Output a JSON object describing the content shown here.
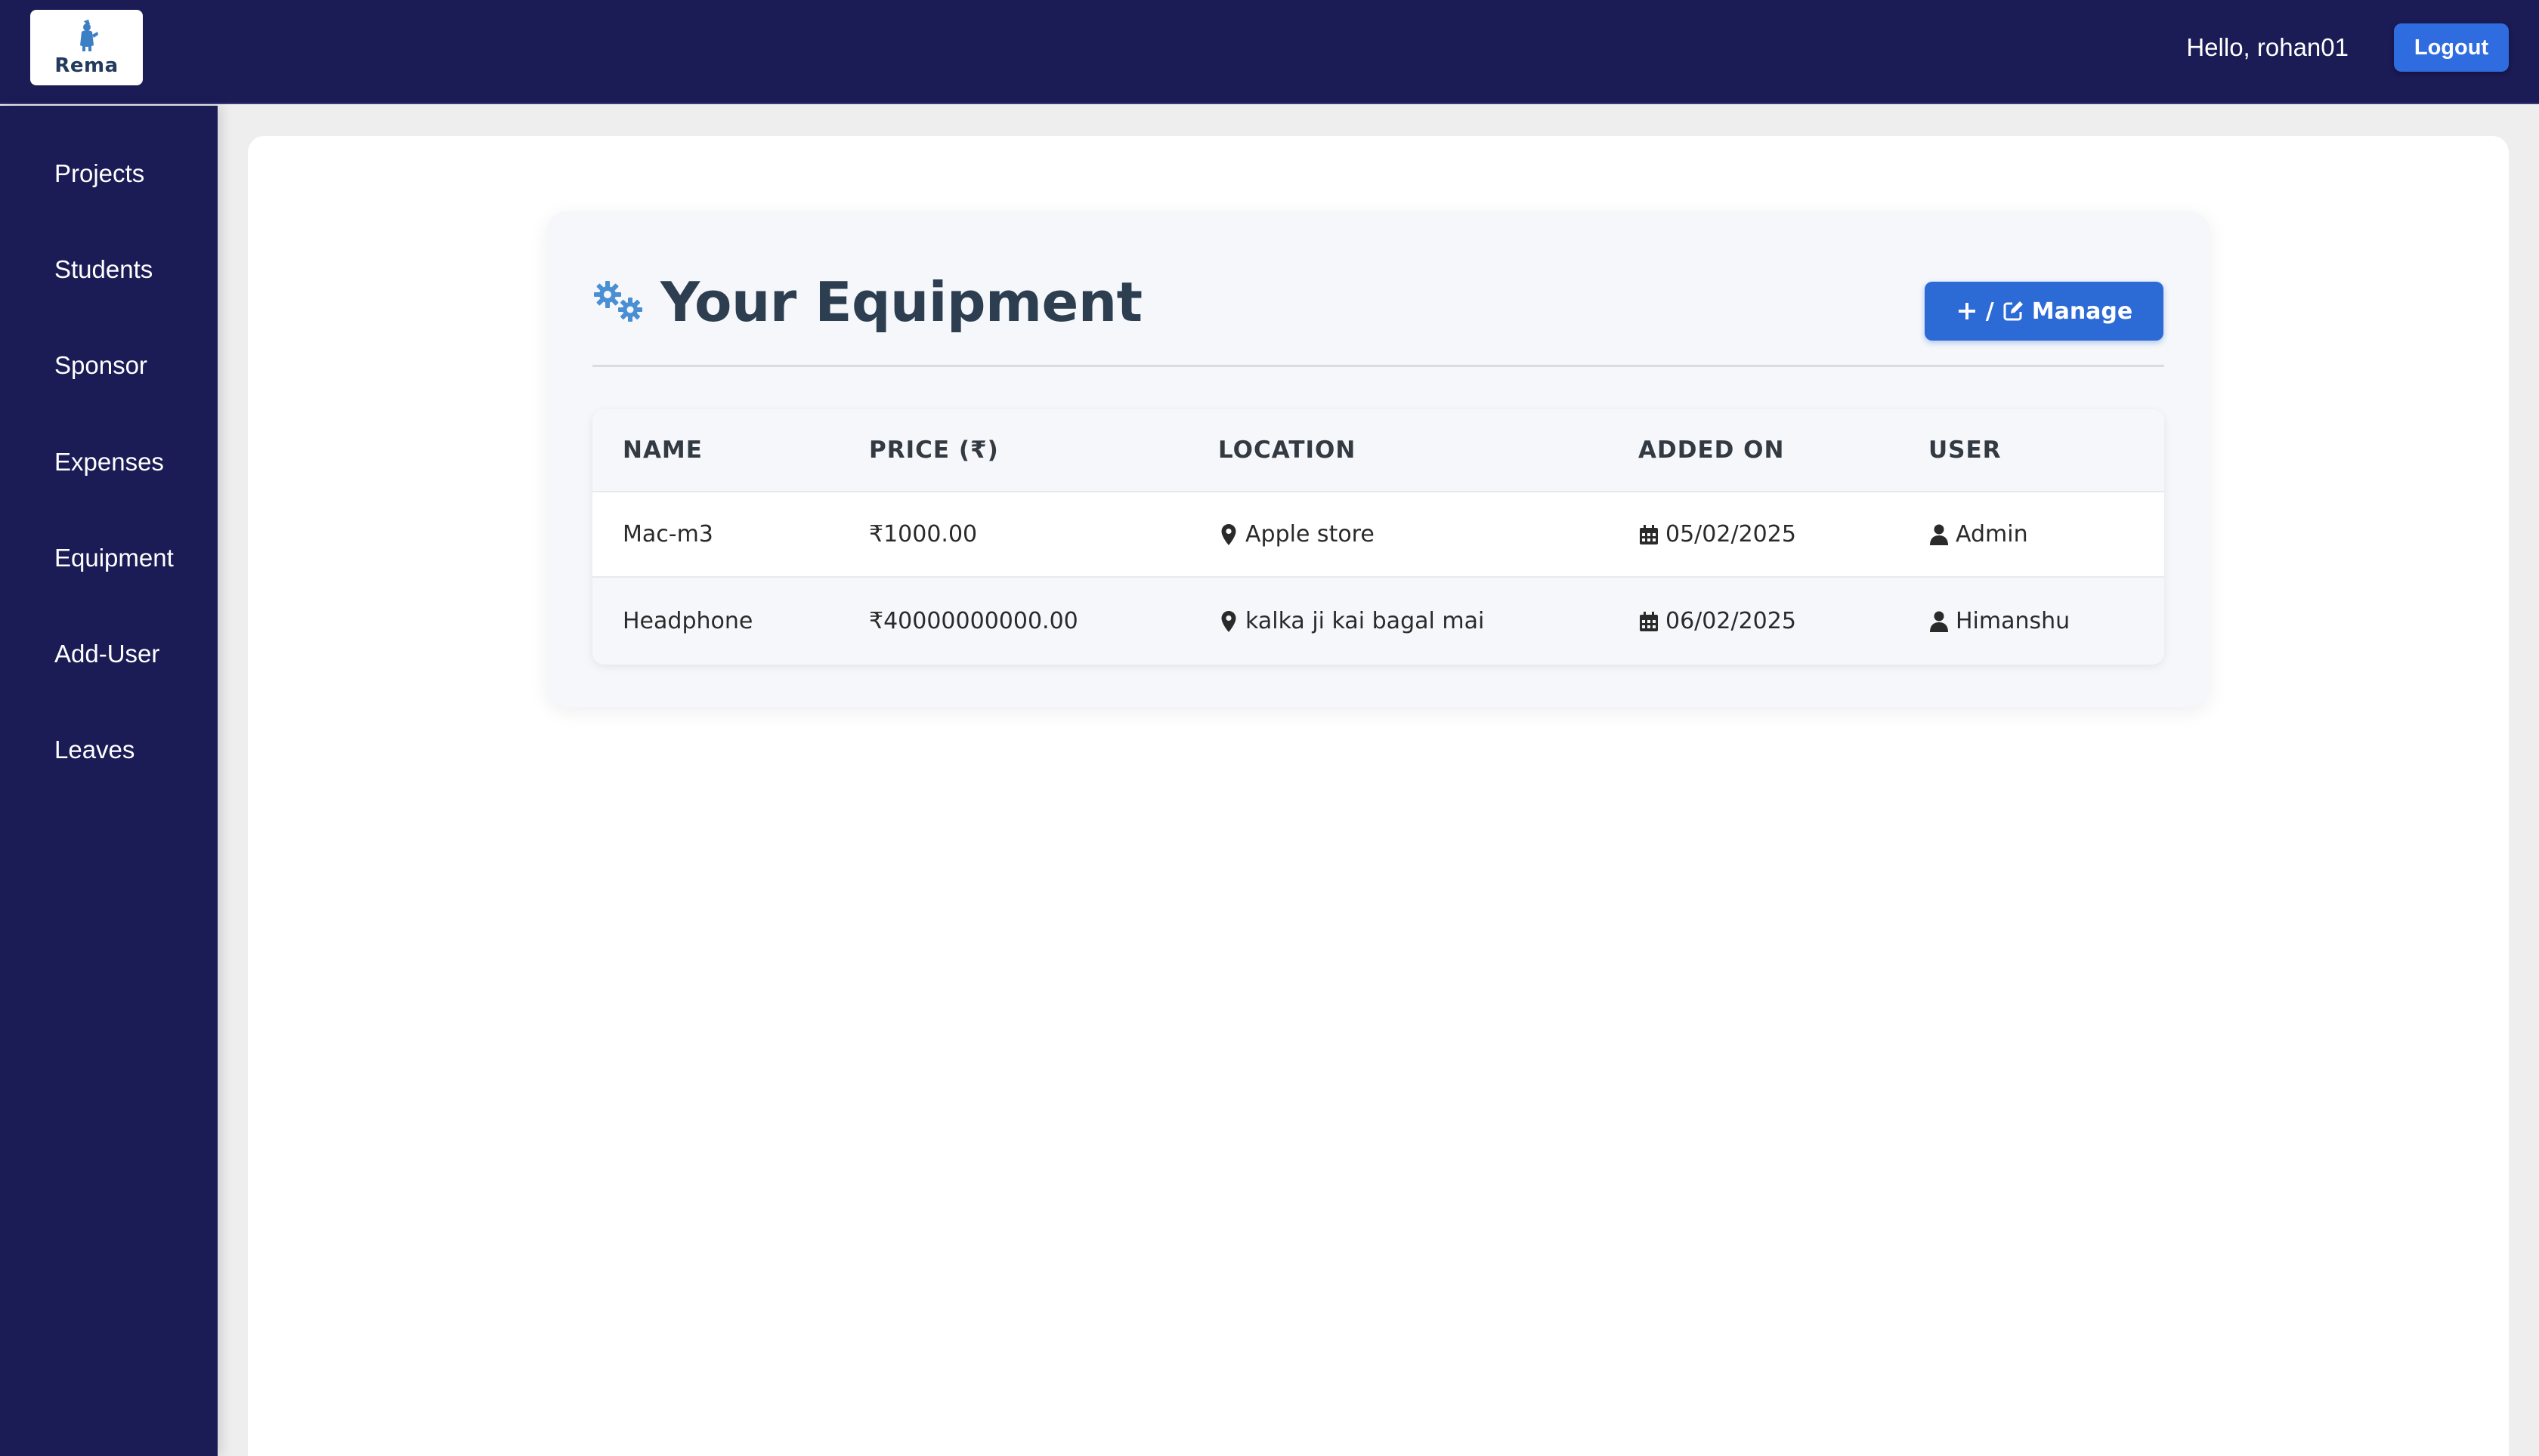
{
  "header": {
    "logo_text": "Rema",
    "greeting": "Hello, rohan01",
    "logout_label": "Logout"
  },
  "sidebar": {
    "items": [
      {
        "label": "Projects"
      },
      {
        "label": "Students"
      },
      {
        "label": "Sponsor"
      },
      {
        "label": "Expenses"
      },
      {
        "label": "Equipment"
      },
      {
        "label": "Add-User"
      },
      {
        "label": "Leaves"
      }
    ]
  },
  "equipment": {
    "title": "Your Equipment",
    "manage_label": "Manage",
    "manage_separator": "/",
    "columns": [
      "NAME",
      "PRICE (₹)",
      "LOCATION",
      "ADDED ON",
      "USER"
    ],
    "rows": [
      {
        "name": "Mac-m3",
        "price": "₹1000.00",
        "location": "Apple store",
        "added_on": "05/02/2025",
        "user": "Admin"
      },
      {
        "name": "Headphone",
        "price": "₹40000000000.00",
        "location": "kalka ji kai bagal mai",
        "added_on": "06/02/2025",
        "user": "Himanshu"
      }
    ]
  },
  "icons": {
    "title_icon": "gears-icon",
    "add_icon": "plus-icon",
    "edit_icon": "edit-icon",
    "location_icon": "map-marker-icon",
    "date_icon": "calendar-icon",
    "user_icon": "user-icon"
  },
  "colors": {
    "nav_bg": "#1b1b56",
    "accent": "#2c6ad6",
    "title_text": "#2c3e50",
    "icon_blue": "#4a8fd4"
  }
}
